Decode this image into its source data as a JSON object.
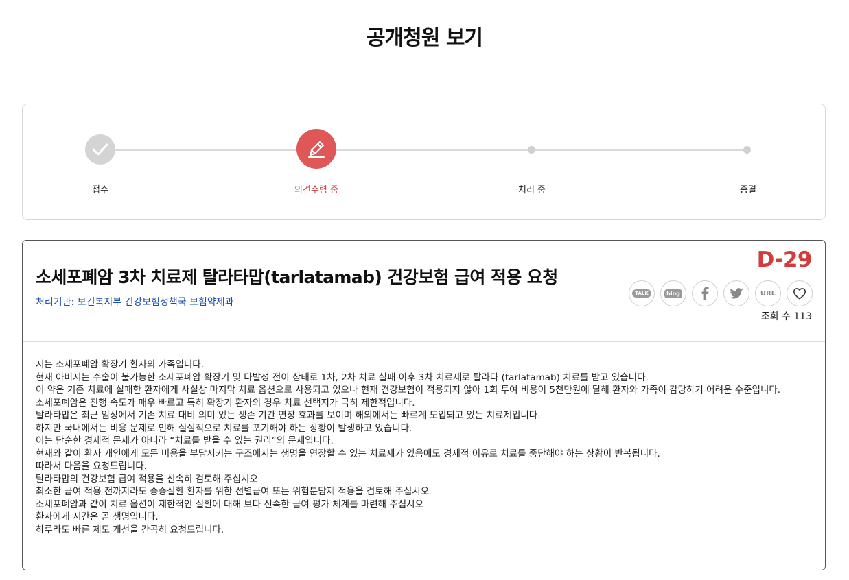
{
  "page": {
    "title": "공개청원 보기"
  },
  "progress": {
    "steps": [
      {
        "label": "접수",
        "state": "done"
      },
      {
        "label": "의견수렴 중",
        "state": "active"
      },
      {
        "label": "처리 중",
        "state": "pending"
      },
      {
        "label": "종결",
        "state": "pending"
      }
    ],
    "colors": {
      "active": "#e05757",
      "done": "#d4d4d4",
      "active_text": "#d23c3c"
    }
  },
  "petition": {
    "title": "소세포폐암 3차 치료제 탈라타맙(tarlatamab) 건강보험 급여 적용 요청",
    "agency": "처리기관: 보건복지부 건강보험정책국 보험약제과",
    "dday": "D-29",
    "share": {
      "talk": "TALK",
      "blog": "blog",
      "facebook_icon": "facebook-icon",
      "twitter_icon": "twitter-icon",
      "url": "URL",
      "like_icon": "heart-icon"
    },
    "views": "조회 수 113",
    "body": [
      "저는 소세포폐암 확장기 환자의 가족입니다.",
      "현재 아버지는 수술이 불가능한 소세포폐암 확장기 및 다발성 전이 상태로 1차, 2차 치료 실패 이후 3차 치료제로 탈라타 (tarlatamab) 치료를 받고 있습니다.",
      "이 약은 기존 치료에 실패한 환자에게 사실상 마지막 치료 옵션으로 사용되고 있으나 현재 건강보험이 적용되지 않아 1회 투여 비용이 5천만원에 달해 환자와 가족이 감당하기 어려운 수준입니다.",
      "소세포폐암은 진행 속도가 매우 빠르고 특히 확장기 환자의 경우 치료 선택지가 극히 제한적입니다.",
      "탈라타맙은 최근 임상에서 기존 치료 대비 의미 있는 생존 기간 연장 효과를 보이며 해외에서는 빠르게 도입되고 있는 치료제입니다.",
      "하지만 국내에서는 비용 문제로 인해 실질적으로 치료를 포기해야 하는 상황이 발생하고 있습니다.",
      "이는 단순한 경제적 문제가 아니라 “치료를 받을 수 있는 권리”의 문제입니다.",
      "현재와 같이 환자 개인에게 모든 비용을 부담시키는 구조에서는 생명을 연장할 수 있는 치료제가 있음에도 경제적 이유로 치료를 중단해야 하는 상황이 반복됩니다.",
      "따라서 다음을 요청드립니다.",
      "탈라타맙의 건강보험 급여 적용을 신속히 검토해 주십시오",
      "최소한 급여 적용 전까지라도 중증질환 환자를 위한 선별급여 또는 위험분담제 적용을 검토해 주십시오",
      "소세포폐암과 같이 치료 옵션이 제한적인 질환에 대해 보다 신속한 급여 평가 체계를 마련해 주십시오",
      "환자에게 시간은 곧 생명입니다.",
      "하루라도 빠른 제도 개선을 간곡히 요청드립니다."
    ]
  }
}
